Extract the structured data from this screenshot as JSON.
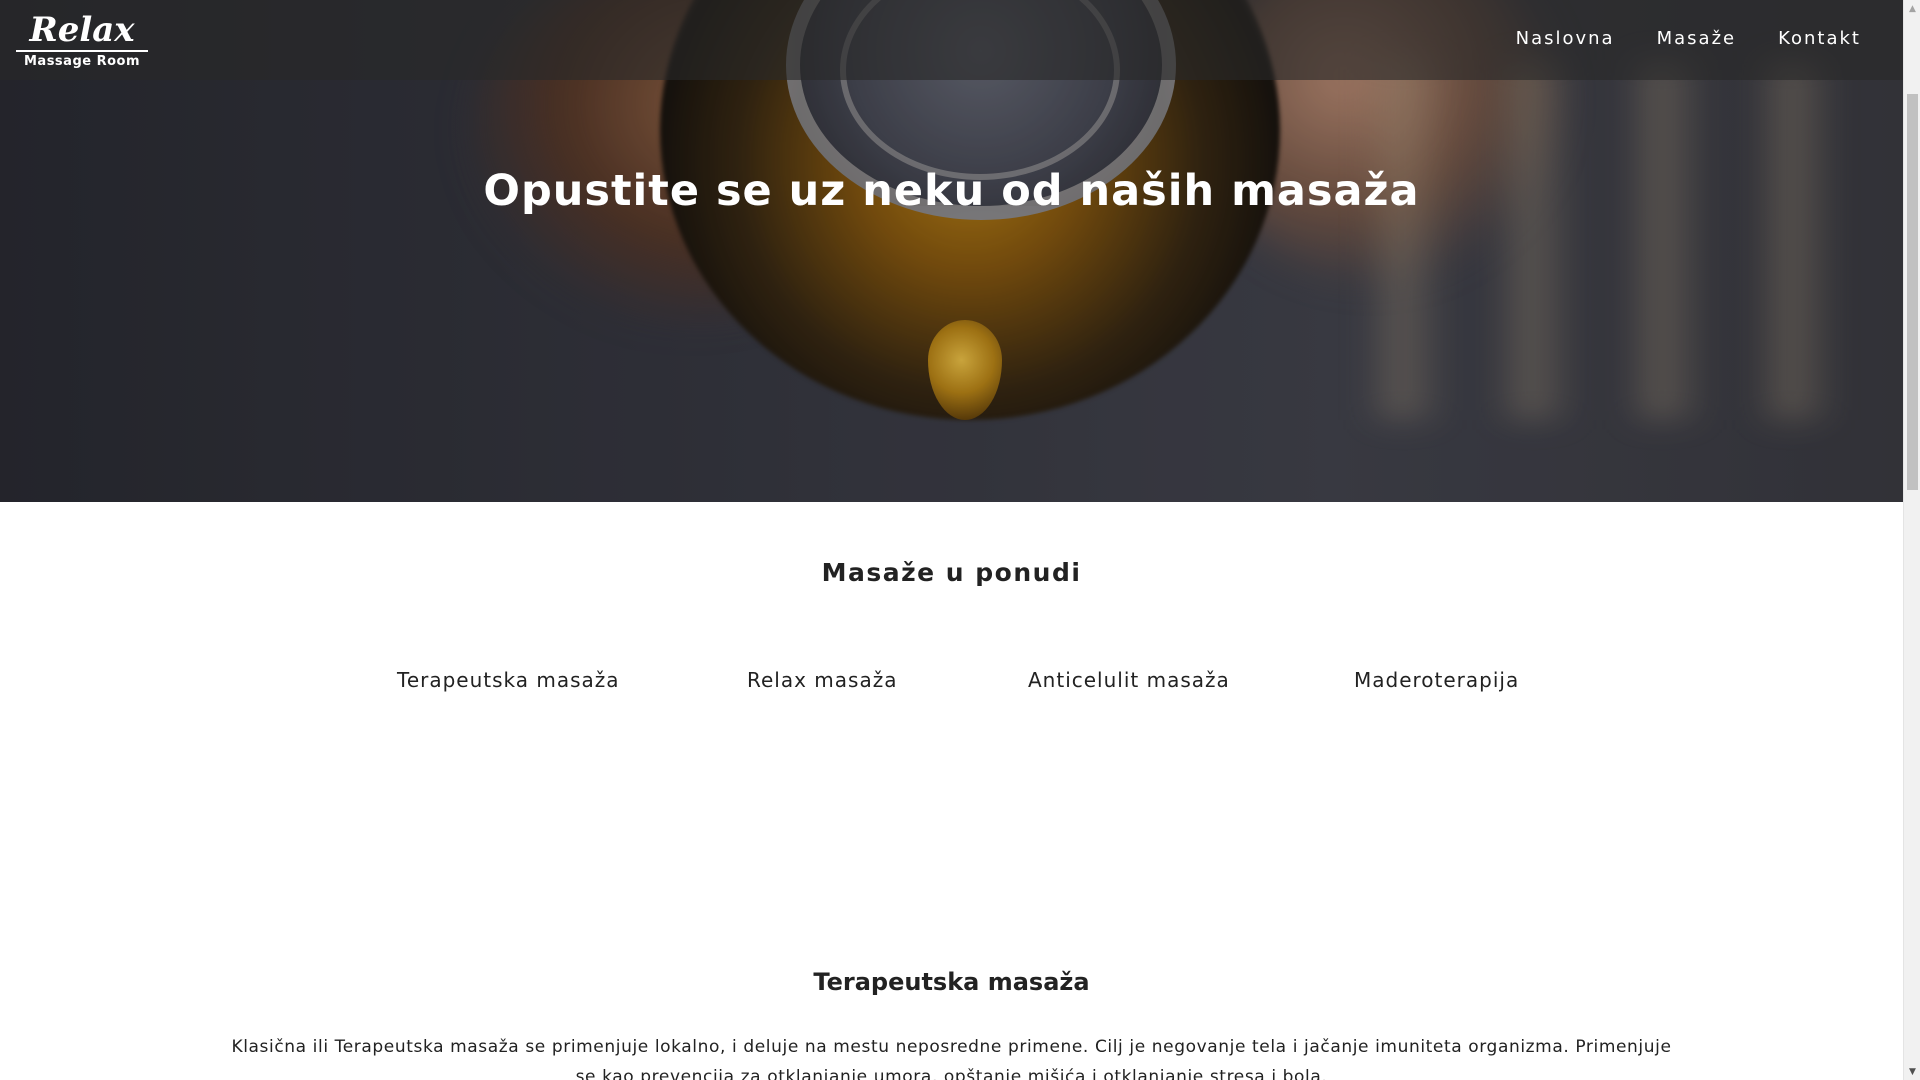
{
  "navbar": {
    "logo": {
      "main": "Relax",
      "sub": "Massage Room"
    },
    "links": [
      {
        "label": "Naslovna"
      },
      {
        "label": "Masaže"
      },
      {
        "label": "Kontakt"
      }
    ]
  },
  "hero": {
    "title": "Opustite se uz neku od naših masaža"
  },
  "offer": {
    "title": "Masaže u ponudi",
    "tabs": [
      {
        "label": "Terapeutska masaža"
      },
      {
        "label": "Relax masaža"
      },
      {
        "label": "Anticelulit masaža"
      },
      {
        "label": "Maderoterapija"
      }
    ]
  },
  "detail": {
    "title": "Terapeutska masaža",
    "text": "Klasična ili Terapeutska masaža se primenjuje lokalno, i deluje na mestu neposredne primene. Cilj je negovanje tela i jačanje imuniteta organizma. Primenjuje se kao prevencija za otklanjanje umora, opštanje mišića i otklanjanje stresa i bola."
  },
  "scrollbar": {
    "up_icon": "triangle-up-icon",
    "down_icon": "triangle-down-icon"
  }
}
